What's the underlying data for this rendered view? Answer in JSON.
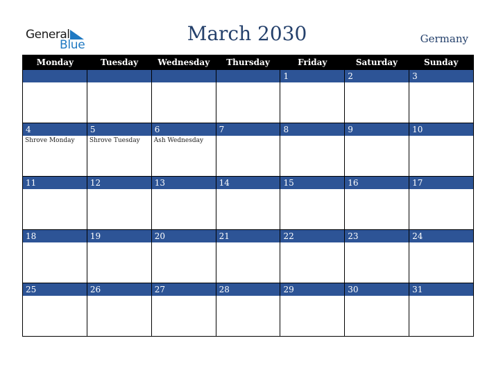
{
  "logo": {
    "line1": "General",
    "line2": "Blue"
  },
  "title": "March 2030",
  "country": "Germany",
  "weekdays": [
    "Monday",
    "Tuesday",
    "Wednesday",
    "Thursday",
    "Friday",
    "Saturday",
    "Sunday"
  ],
  "weeks": [
    [
      {
        "d": "",
        "e": ""
      },
      {
        "d": "",
        "e": ""
      },
      {
        "d": "",
        "e": ""
      },
      {
        "d": "",
        "e": ""
      },
      {
        "d": "1",
        "e": ""
      },
      {
        "d": "2",
        "e": ""
      },
      {
        "d": "3",
        "e": ""
      }
    ],
    [
      {
        "d": "4",
        "e": "Shrove Monday"
      },
      {
        "d": "5",
        "e": "Shrove Tuesday"
      },
      {
        "d": "6",
        "e": "Ash Wednesday"
      },
      {
        "d": "7",
        "e": ""
      },
      {
        "d": "8",
        "e": ""
      },
      {
        "d": "9",
        "e": ""
      },
      {
        "d": "10",
        "e": ""
      }
    ],
    [
      {
        "d": "11",
        "e": ""
      },
      {
        "d": "12",
        "e": ""
      },
      {
        "d": "13",
        "e": ""
      },
      {
        "d": "14",
        "e": ""
      },
      {
        "d": "15",
        "e": ""
      },
      {
        "d": "16",
        "e": ""
      },
      {
        "d": "17",
        "e": ""
      }
    ],
    [
      {
        "d": "18",
        "e": ""
      },
      {
        "d": "19",
        "e": ""
      },
      {
        "d": "20",
        "e": ""
      },
      {
        "d": "21",
        "e": ""
      },
      {
        "d": "22",
        "e": ""
      },
      {
        "d": "23",
        "e": ""
      },
      {
        "d": "24",
        "e": ""
      }
    ],
    [
      {
        "d": "25",
        "e": ""
      },
      {
        "d": "26",
        "e": ""
      },
      {
        "d": "27",
        "e": ""
      },
      {
        "d": "28",
        "e": ""
      },
      {
        "d": "29",
        "e": ""
      },
      {
        "d": "30",
        "e": ""
      },
      {
        "d": "31",
        "e": ""
      }
    ]
  ]
}
